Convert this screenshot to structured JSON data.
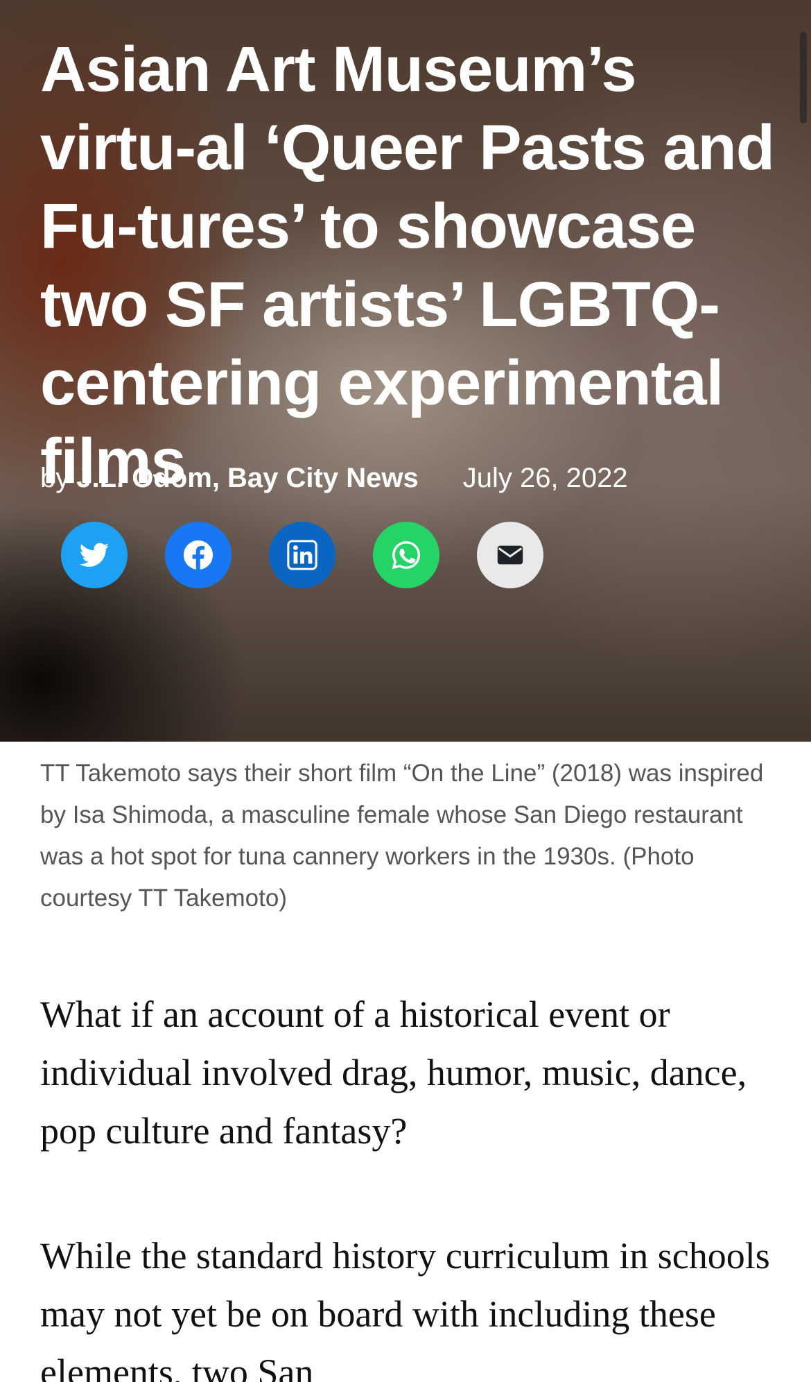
{
  "article": {
    "title": "Asian Art Museum’s virtu-al ‘Queer Pasts and Fu-tures’ to showcase two SF artists’ LGBTQ-centering experimental films",
    "by_prefix": "by",
    "author": "J.L. Odom, Bay City News",
    "date": "July 26, 2022"
  },
  "share": [
    {
      "name": "twitter-icon",
      "color": "#1da1f2"
    },
    {
      "name": "facebook-icon",
      "color": "#1877f2"
    },
    {
      "name": "linkedin-icon",
      "color": "#0a66c2"
    },
    {
      "name": "whatsapp-icon",
      "color": "#25d366"
    },
    {
      "name": "email-icon",
      "color": "#e9e9e9"
    }
  ],
  "caption": "TT Takemoto says their short film “On the Line” (2018) was inspired by Isa Shimoda, a masculine female whose San Diego restaurant was a hot spot for tuna cannery workers in the 1930s. (Photo courtesy TT Takemoto)",
  "body": {
    "p1": "What if an account of a historical event or individual involved drag, humor, music, dance, pop culture and fantasy?",
    "p2": "While the standard history curriculum in schools may not yet be on board with including these elements, two San"
  }
}
